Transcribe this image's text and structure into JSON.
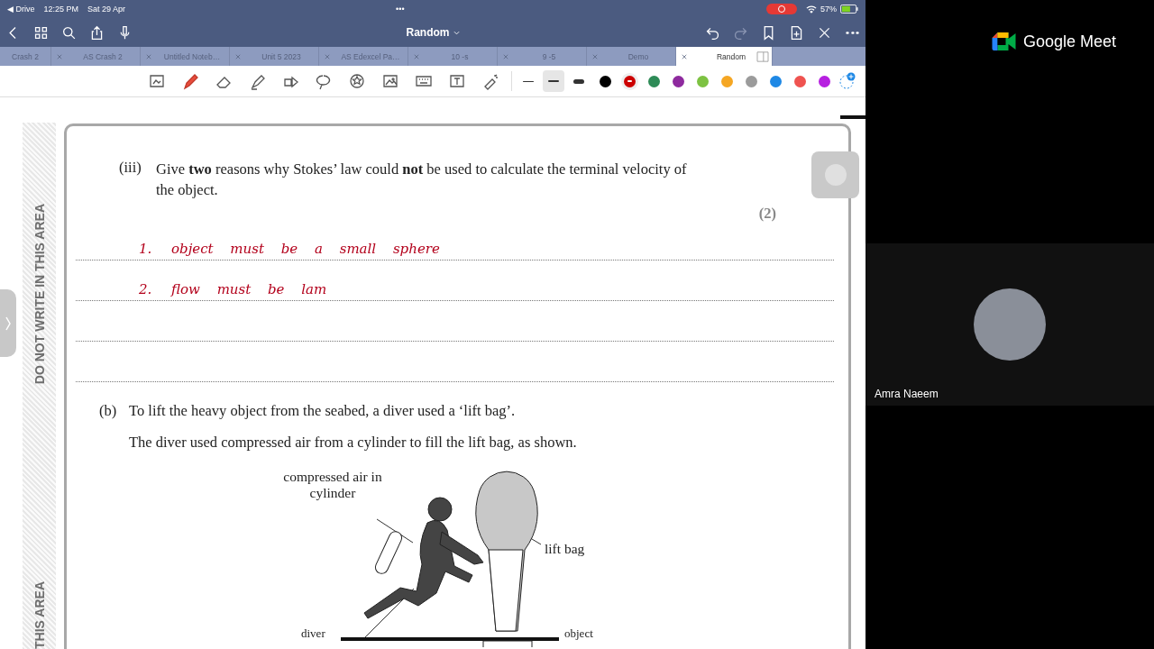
{
  "status_bar": {
    "back_app": "◀ Drive",
    "time": "12:25 PM",
    "date": "Sat 29 Apr",
    "dots": "•••",
    "battery": "57%",
    "recording": true
  },
  "nav": {
    "title": "Random"
  },
  "tabs": [
    {
      "label": "Crash 2",
      "selected": false
    },
    {
      "label": "AS Crash 2",
      "selected": false
    },
    {
      "label": "Untitled Noteb…",
      "selected": false
    },
    {
      "label": "Unit 5 2023",
      "selected": false
    },
    {
      "label": "AS Edexcel Pa…",
      "selected": false
    },
    {
      "label": "10 -s",
      "selected": false
    },
    {
      "label": "9 -5",
      "selected": false
    },
    {
      "label": "Demo",
      "selected": false
    },
    {
      "label": "Random",
      "selected": true
    }
  ],
  "tools": [
    {
      "kind": "image-lasso",
      "selected": false
    },
    {
      "kind": "pen",
      "selected": true
    },
    {
      "kind": "eraser",
      "selected": false
    },
    {
      "kind": "highlighter",
      "selected": false
    },
    {
      "kind": "shapes",
      "selected": false
    },
    {
      "kind": "lasso",
      "selected": false
    },
    {
      "kind": "sticker",
      "selected": false
    },
    {
      "kind": "image",
      "selected": false
    },
    {
      "kind": "keyboard",
      "selected": false
    },
    {
      "kind": "text",
      "selected": false
    },
    {
      "kind": "laser",
      "selected": false
    }
  ],
  "stroke_widths": [
    {
      "kind": "thin",
      "selected": false
    },
    {
      "kind": "medium",
      "selected": true
    },
    {
      "kind": "thick",
      "selected": false
    }
  ],
  "colors": [
    {
      "color": "#000000",
      "selected": false
    },
    {
      "color": "#cc0000",
      "selected": true
    },
    {
      "color": "#2e8b57",
      "selected": false
    },
    {
      "color": "#8e2a9e",
      "selected": false
    },
    {
      "color": "#7dc242",
      "selected": false
    },
    {
      "color": "#f5a623",
      "selected": false
    },
    {
      "color": "#9b9b9b",
      "selected": false
    },
    {
      "color": "#1e88e5",
      "selected": false
    },
    {
      "color": "#ef5350",
      "selected": false
    },
    {
      "color": "#b620e0",
      "selected": false
    }
  ],
  "margin_labels": [
    "DO NOT WRITE IN THIS AREA",
    "THIS AREA"
  ],
  "question": {
    "number": "(iii)",
    "text": "Give **two** reasons why Stokes’ law could **not** be used to calculate the terminal velocity of the object.",
    "marks": "(2)"
  },
  "answers": [
    {
      "number": "1.",
      "text": "object must be a small sphere"
    },
    {
      "number": "2.",
      "text": "flow must be lam"
    }
  ],
  "part_b": {
    "number": "(b)",
    "lines": [
      "To lift the heavy object from the seabed, a diver used a ‘lift bag’.",
      "The diver used compressed air from a cylinder to fill the lift bag, as shown."
    ]
  },
  "figure": {
    "labels": [
      "compressed air in cylinder",
      "lift bag",
      "diver",
      "object"
    ]
  },
  "meet": {
    "brand": "Google Meet",
    "participant": "Amra Naeem"
  }
}
